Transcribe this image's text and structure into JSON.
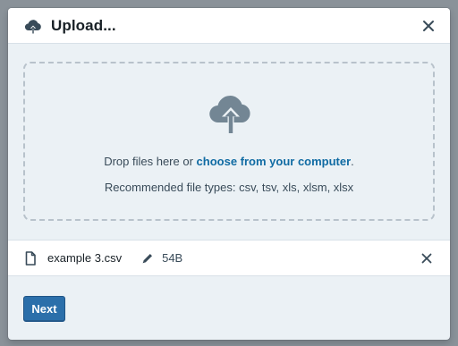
{
  "dialog": {
    "title": "Upload...",
    "header_icon": "cloud-upload-icon",
    "close_icon": "close-icon"
  },
  "dropzone": {
    "icon": "cloud-upload-icon",
    "text_before": "Drop files here or ",
    "link_text": "choose from your computer",
    "text_after": ".",
    "recommended": "Recommended file types: csv, tsv, xls, xlsm, xlsx"
  },
  "file": {
    "icon": "document-icon",
    "name": "example 3.csv",
    "edit_icon": "pencil-icon",
    "size": "54B",
    "remove_icon": "close-icon"
  },
  "footer": {
    "next_label": "Next"
  },
  "colors": {
    "link": "#106ba3",
    "primary_button": "#2b6faa",
    "body_background": "#ebf1f5",
    "icon_gray": "#738694"
  }
}
